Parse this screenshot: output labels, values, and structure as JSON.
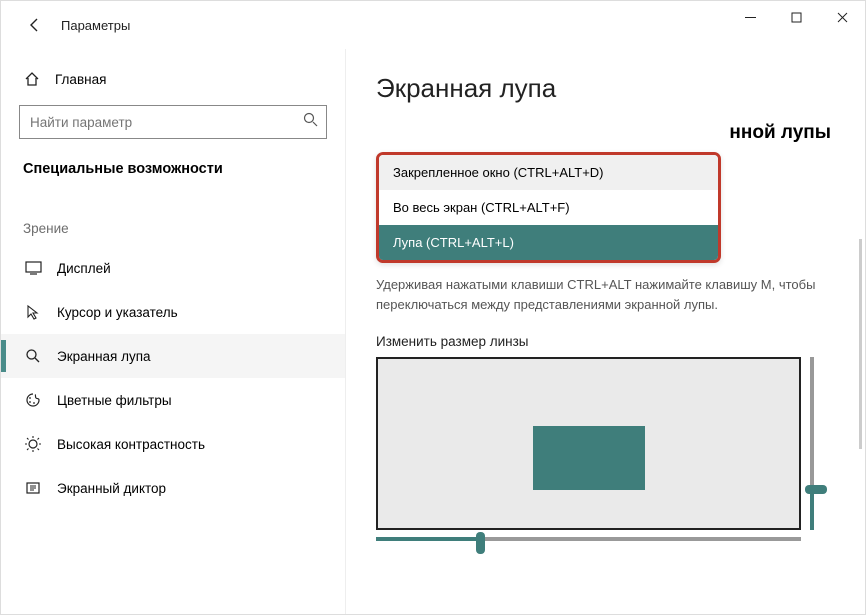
{
  "window": {
    "title": "Параметры"
  },
  "sidebar": {
    "home": "Главная",
    "search_placeholder": "Найти параметр",
    "category": "Специальные возможности",
    "group": "Зрение",
    "items": [
      {
        "label": "Дисплей"
      },
      {
        "label": "Курсор и указатель"
      },
      {
        "label": "Экранная лупа"
      },
      {
        "label": "Цветные фильтры"
      },
      {
        "label": "Высокая контрастность"
      },
      {
        "label": "Экранный диктор"
      }
    ]
  },
  "main": {
    "page_title": "Экранная лупа",
    "section_head_partial": "нной лупы",
    "dropdown": {
      "options": [
        "Закрепленное окно (CTRL+ALT+D)",
        "Во весь экран (CTRL+ALT+F)",
        "Лупа (CTRL+ALT+L)"
      ],
      "selected_index": 2
    },
    "help": "Удерживая нажатыми клавиши CTRL+ALT нажимайте клавишу M, чтобы переключаться между представлениями экранной лупы.",
    "resize_label": "Изменить размер линзы"
  }
}
